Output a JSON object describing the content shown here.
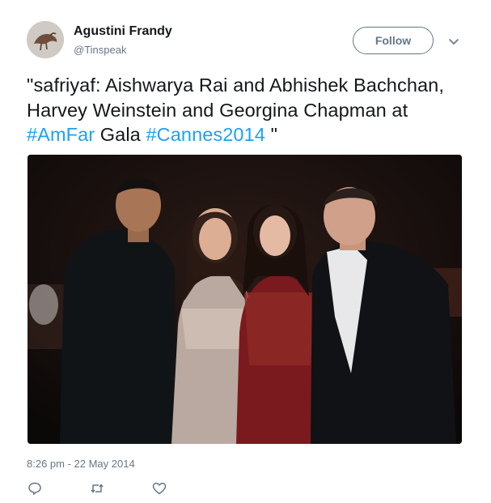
{
  "user": {
    "name": "Agustini Frandy",
    "handle": "@Tinspeak"
  },
  "follow_label": "Follow",
  "tweet": {
    "part1": "\"safriyaf: Aishwarya Rai and Abhishek Bachchan, Harvey Weinstein and Georgina Chapman at ",
    "tag1": "#AmFar",
    "part2": " Gala ",
    "tag2": "#Cannes2014",
    "part3": " \""
  },
  "timestamp": "8:26 pm - 22 May 2014",
  "actions": [
    "reply-icon",
    "retweet-icon",
    "like-icon"
  ],
  "colors": {
    "link": "#1da1f2",
    "secondary_text": "#657786",
    "primary_text": "#14171a"
  }
}
